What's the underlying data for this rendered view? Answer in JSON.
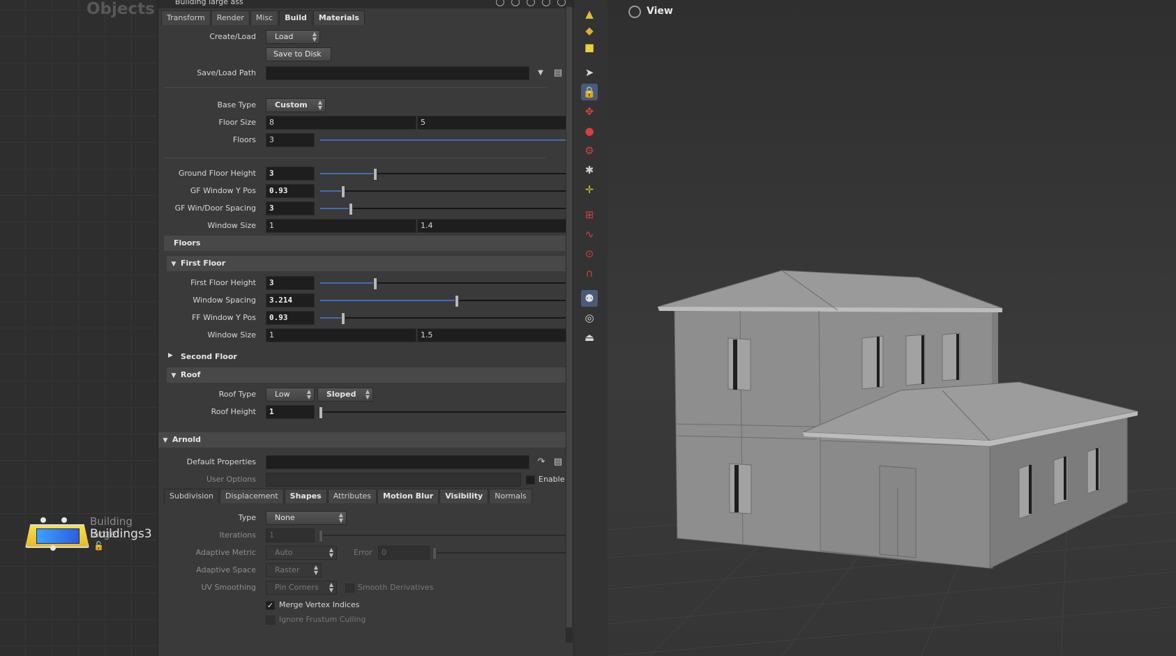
{
  "network": {
    "title": "Objects",
    "node": {
      "label_top": "Building large",
      "label_bottom": "Buildings3"
    }
  },
  "params": {
    "window_title": "Building large ass",
    "main_tabs": [
      {
        "label": "Transform"
      },
      {
        "label": "Render"
      },
      {
        "label": "Misc"
      },
      {
        "label": "Build"
      },
      {
        "label": "Materials"
      }
    ],
    "create_load": {
      "label": "Create/Load",
      "value": "Load"
    },
    "save_button": "Save to Disk",
    "save_path": {
      "label": "Save/Load Path",
      "value": ""
    },
    "base_type": {
      "label": "Base Type",
      "value": "Custom"
    },
    "floor_size": {
      "label": "Floor Size",
      "x": "8",
      "y": "5"
    },
    "floors": {
      "label": "Floors",
      "value": "3",
      "fraction": 1.0
    },
    "ground_floor_height": {
      "label": "Ground Floor Height",
      "value": "3",
      "fraction": 0.22
    },
    "gf_window_y": {
      "label": "GF Window Y Pos",
      "value": "0.93",
      "fraction": 0.09
    },
    "gf_spacing": {
      "label": "GF Win/Door Spacing",
      "value": "3",
      "fraction": 0.12
    },
    "gf_window_size": {
      "label": "Window Size",
      "x": "1",
      "y": "1.4"
    },
    "floors_folder": "Floors",
    "first_floor": {
      "title": "First Floor",
      "height": {
        "label": "First Floor Height",
        "value": "3",
        "fraction": 0.22
      },
      "spacing": {
        "label": "Window Spacing",
        "value": "3.214",
        "fraction": 0.55
      },
      "window_y": {
        "label": "FF Window Y Pos",
        "value": "0.93",
        "fraction": 0.09
      },
      "window_size": {
        "label": "Window Size",
        "x": "1",
        "y": "1.5"
      }
    },
    "second_floor": {
      "title": "Second Floor"
    },
    "roof": {
      "title": "Roof",
      "type": {
        "label": "Roof Type",
        "value1": "Low",
        "value2": "Sloped"
      },
      "height": {
        "label": "Roof Height",
        "value": "1",
        "fraction": 0.0
      }
    },
    "arnold": {
      "title": "Arnold",
      "default_props": {
        "label": "Default Properties",
        "value": ""
      },
      "user_options": {
        "label": "User Options",
        "enable": "Enable"
      },
      "sub_tabs": [
        {
          "label": "Subdivision"
        },
        {
          "label": "Displacement"
        },
        {
          "label": "Shapes"
        },
        {
          "label": "Attributes"
        },
        {
          "label": "Motion Blur"
        },
        {
          "label": "Visibility"
        },
        {
          "label": "Normals"
        }
      ],
      "type": {
        "label": "Type",
        "value": "None"
      },
      "iterations": {
        "label": "Iterations",
        "value": "1"
      },
      "adaptive_metric": {
        "label": "Adaptive Metric",
        "value": "Auto",
        "error_label": "Error",
        "error_value": "0"
      },
      "adaptive_space": {
        "label": "Adaptive Space",
        "value": "Raster"
      },
      "uv_smoothing": {
        "label": "UV Smoothing",
        "value": "Pin Corners",
        "smooth_label": "Smooth Derivatives"
      },
      "merge_vertex": {
        "label": "Merge Vertex Indices",
        "checked": true
      },
      "ignore_frustum": {
        "label": "Ignore Frustum Culling",
        "checked": false
      }
    }
  },
  "viewport": {
    "title": "View"
  },
  "colors": {
    "accent": "#3e6fb8",
    "node": "#f0d040",
    "panel": "#3a3a3a"
  }
}
